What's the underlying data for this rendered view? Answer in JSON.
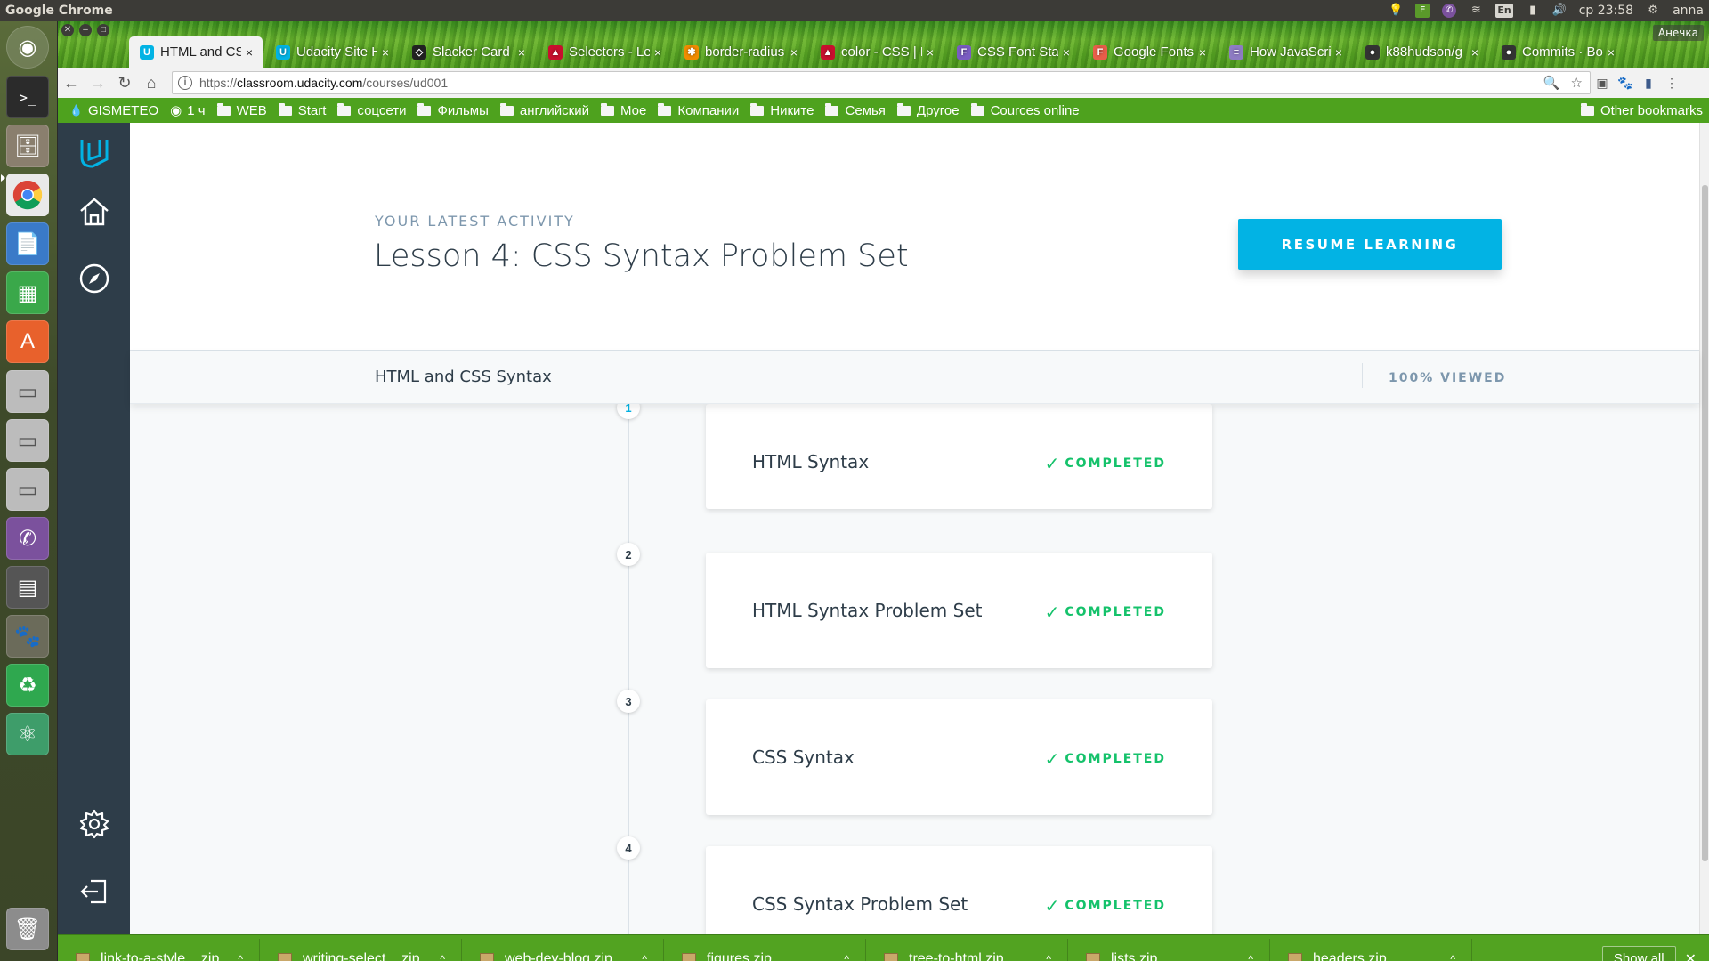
{
  "system": {
    "app_name": "Google Chrome",
    "time": "ср 23:58",
    "user": "anna",
    "keyboard": "En"
  },
  "browser": {
    "profile": "Анечка",
    "tabs": [
      {
        "title": "HTML and CS",
        "icon": "udacity-icon",
        "active": true
      },
      {
        "title": "Udacity Site H",
        "icon": "udacity-icon",
        "active": false
      },
      {
        "title": "Slacker Card",
        "icon": "codepen-icon",
        "active": false
      },
      {
        "title": "Selectors - Le",
        "icon": "mdn-icon",
        "active": false
      },
      {
        "title": "border-radius",
        "icon": "asterisk-icon",
        "active": false
      },
      {
        "title": "color - CSS | M",
        "icon": "mdn-icon",
        "active": false
      },
      {
        "title": "CSS Font Stac",
        "icon": "cssfontstack-icon",
        "active": false
      },
      {
        "title": "Google Fonts",
        "icon": "googlefonts-icon",
        "active": false
      },
      {
        "title": "How JavaScri",
        "icon": "page-icon",
        "active": false
      },
      {
        "title": "k88hudson/g",
        "icon": "github-icon",
        "active": false
      },
      {
        "title": "Commits · Bo",
        "icon": "github-icon",
        "active": false
      }
    ],
    "url_prefix": "https://",
    "url_host": "classroom.udacity.com",
    "url_path": "/courses/ud001",
    "bookmarks": [
      "GISMETEO",
      "1 ч",
      "WEB",
      "Start",
      "соцсети",
      "Фильмы",
      "английский",
      "Мое",
      "Компании",
      "Никите",
      "Семья",
      "Другое",
      "Cources online"
    ],
    "other_bookmarks": "Other bookmarks"
  },
  "page": {
    "kicker": "YOUR LATEST ACTIVITY",
    "title": "Lesson 4: CSS Syntax Problem Set",
    "resume_label": "RESUME LEARNING",
    "section_label": "HTML and CSS Syntax",
    "progress_label": "100% VIEWED",
    "concepts": [
      {
        "number": "1",
        "title": "HTML Syntax",
        "status": "COMPLETED"
      },
      {
        "number": "2",
        "title": "HTML Syntax Problem Set",
        "status": "COMPLETED"
      },
      {
        "number": "3",
        "title": "CSS Syntax",
        "status": "COMPLETED"
      },
      {
        "number": "4",
        "title": "CSS Syntax Problem Set",
        "status": "COMPLETED"
      }
    ],
    "colors": {
      "accent": "#02b3e4",
      "completed": "#15c26b",
      "nav": "#2e3d49"
    }
  },
  "downloads": {
    "items": [
      "link-to-a-style....zip",
      "writing-select....zip",
      "web-dev-blog.zip",
      "figures.zip",
      "tree-to-html.zip",
      "lists.zip",
      "headers.zip"
    ],
    "show_all": "Show all"
  }
}
